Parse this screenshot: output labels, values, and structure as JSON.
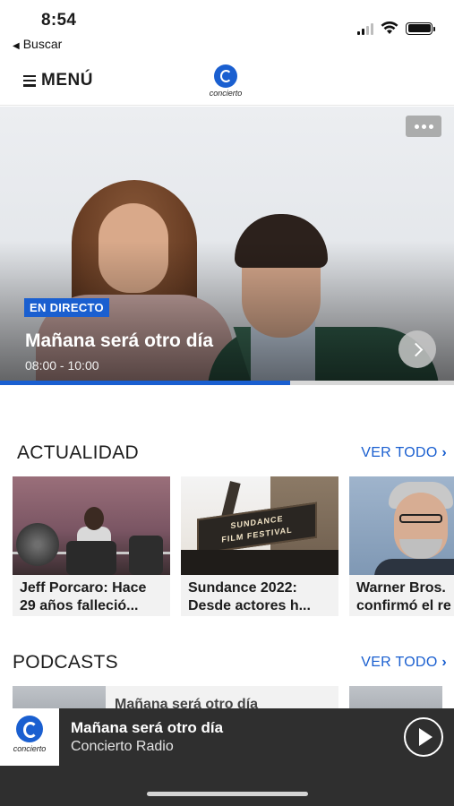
{
  "status_bar": {
    "time": "8:54",
    "back_label": "Buscar"
  },
  "header": {
    "menu_label": "MENÚ",
    "logo_text": "concierto"
  },
  "hero": {
    "badge": "EN DIRECTO",
    "title": "Mañana será otro día",
    "time_range": "08:00 - 10:00",
    "progress_fraction": 0.64
  },
  "actualidad": {
    "title": "ACTUALIDAD",
    "see_all": "VER TODO",
    "cards": [
      {
        "caption": "Jeff Porcaro: Hace\n29 años falleció..."
      },
      {
        "caption": "Sundance 2022:\nDesde actores h..."
      },
      {
        "caption": "Warner Bros.\nconfirmó el re"
      }
    ],
    "sign_text": "SUNDANCE\nFILM FESTIVAL"
  },
  "podcasts": {
    "title": "PODCASTS",
    "see_all": "VER TODO",
    "peek_title": "Mañana será otro día"
  },
  "player": {
    "title": "Mañana será otro día",
    "subtitle": "Concierto Radio",
    "logo_text": "concierto"
  },
  "colors": {
    "accent": "#1a5fd0",
    "player_bg": "#2f2f2f"
  }
}
